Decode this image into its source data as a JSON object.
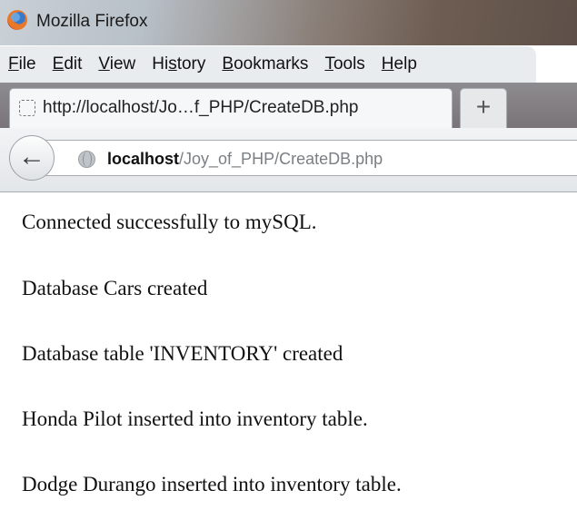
{
  "window": {
    "app_title": "Mozilla Firefox",
    "icon": "firefox-logo"
  },
  "menubar": {
    "items": [
      {
        "accel": "F",
        "rest": "ile"
      },
      {
        "accel": "E",
        "rest": "dit"
      },
      {
        "accel": "V",
        "rest": "iew"
      },
      {
        "accel": "",
        "rest": "Hi",
        "accel2": "s",
        "rest2": "tory"
      },
      {
        "accel": "B",
        "rest": "ookmarks"
      },
      {
        "accel": "T",
        "rest": "ools"
      },
      {
        "accel": "H",
        "rest": "elp"
      }
    ]
  },
  "tabs": {
    "active_label": "http://localhost/Jo…f_PHP/CreateDB.php",
    "new_tab_label": "+"
  },
  "navbar": {
    "url_host": "localhost",
    "url_path": "/Joy_of_PHP/CreateDB.php"
  },
  "page": {
    "lines": [
      "Connected successfully to mySQL.",
      "Database Cars created",
      "Database table 'INVENTORY' created",
      "Honda Pilot inserted into inventory table.",
      "Dodge Durango inserted into inventory table."
    ]
  }
}
